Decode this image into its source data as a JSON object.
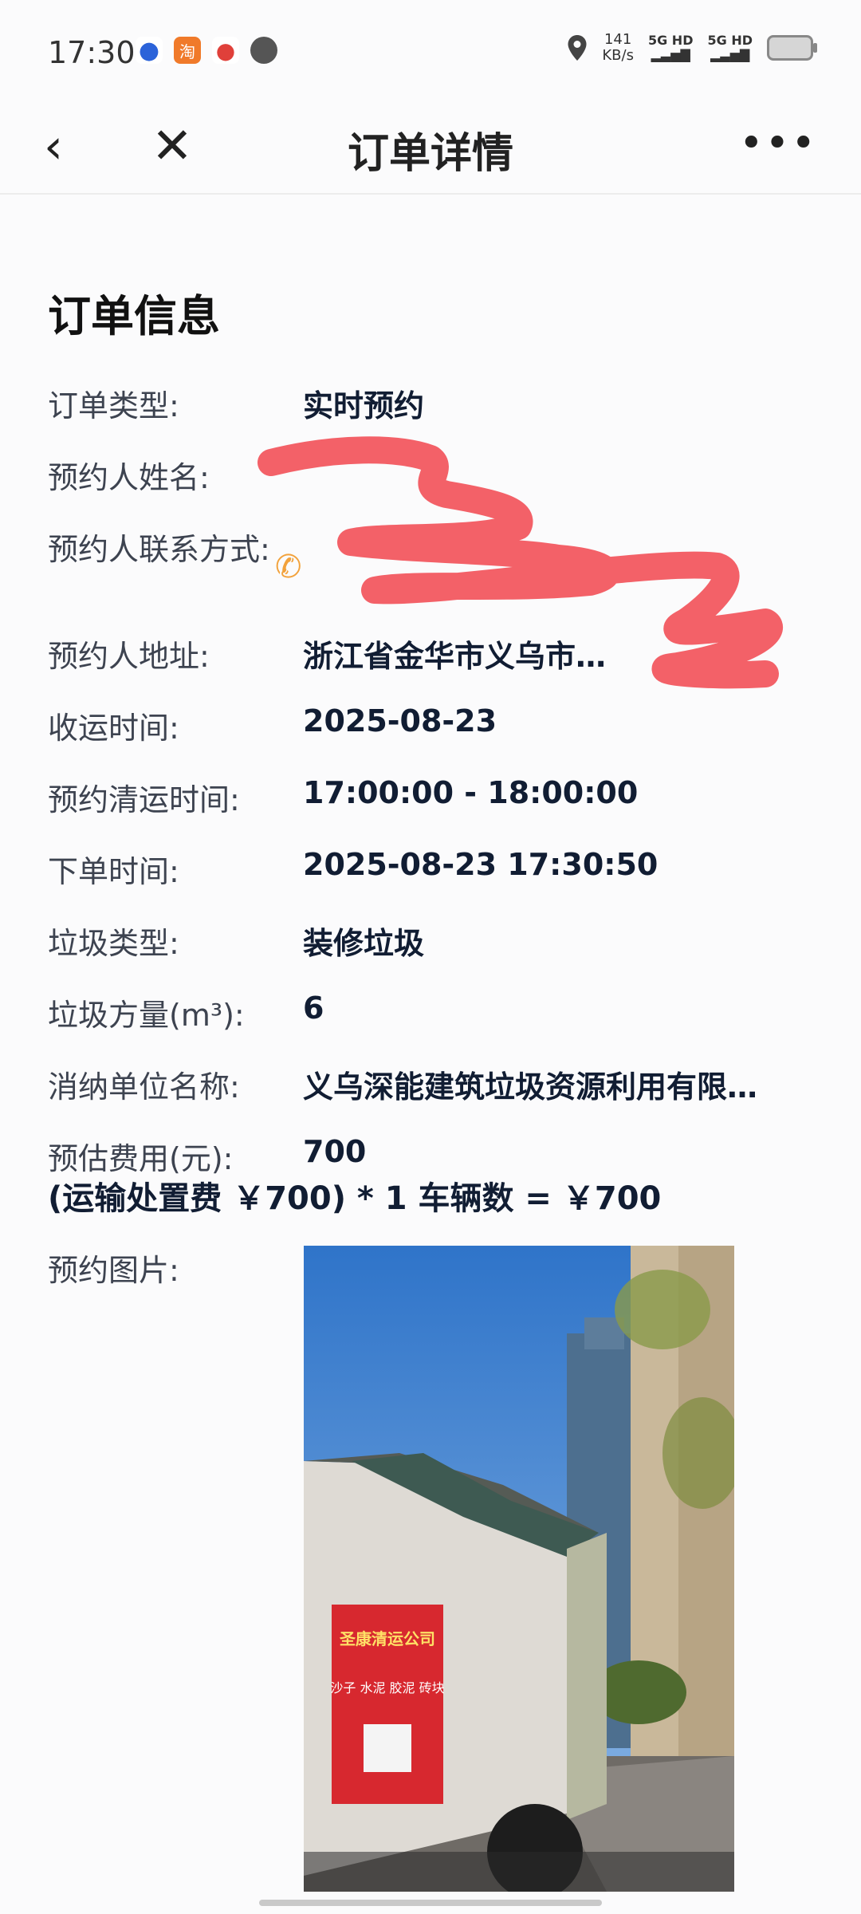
{
  "status_bar": {
    "time": "17:30",
    "net_speed_value": "141",
    "net_speed_unit": "KB/s",
    "sig1": "5G HD",
    "sig2": "5G HD"
  },
  "nav": {
    "title": "订单详情"
  },
  "section_title": "订单信息",
  "fields": {
    "order_type": {
      "label": "订单类型:",
      "value": "实时预约"
    },
    "booker_name": {
      "label": "预约人姓名:",
      "value": ""
    },
    "booker_contact": {
      "label": "预约人联系方式:",
      "value": ""
    },
    "booker_address": {
      "label": "预约人地址:",
      "value": "浙江省金华市义乌市…"
    },
    "collect_date": {
      "label": "收运时间:",
      "value": "2025-08-23"
    },
    "clear_time": {
      "label": "预约清运时间:",
      "value": "17:00:00 - 18:00:00"
    },
    "order_time": {
      "label": "下单时间:",
      "value": "2025-08-23 17:30:50"
    },
    "waste_type": {
      "label": "垃圾类型:",
      "value": "装修垃圾"
    },
    "waste_volume": {
      "label": "垃圾方量(m³):",
      "value": "6"
    },
    "disposal_unit": {
      "label": "消纳单位名称:",
      "value": "义乌深能建筑垃圾资源利用有限…"
    },
    "estimated_fee": {
      "label": "预估费用(元):",
      "value": "700"
    }
  },
  "fee_formula": "(运输处置费 ￥700) * 1 车辆数 = ￥700",
  "photo_section": {
    "label": "预约图片:",
    "truck_sign_company": "圣康清运公司",
    "truck_sign_items": "沙子 水泥 胶泥 砖块"
  },
  "colors": {
    "accent_phone": "#f2a23c",
    "redaction": "#f2545b",
    "text_primary": "#111d33",
    "text_label": "#3d4350"
  },
  "icons": [
    "back-icon",
    "close-icon",
    "more-icon",
    "phone-icon",
    "location-icon",
    "battery-icon"
  ]
}
